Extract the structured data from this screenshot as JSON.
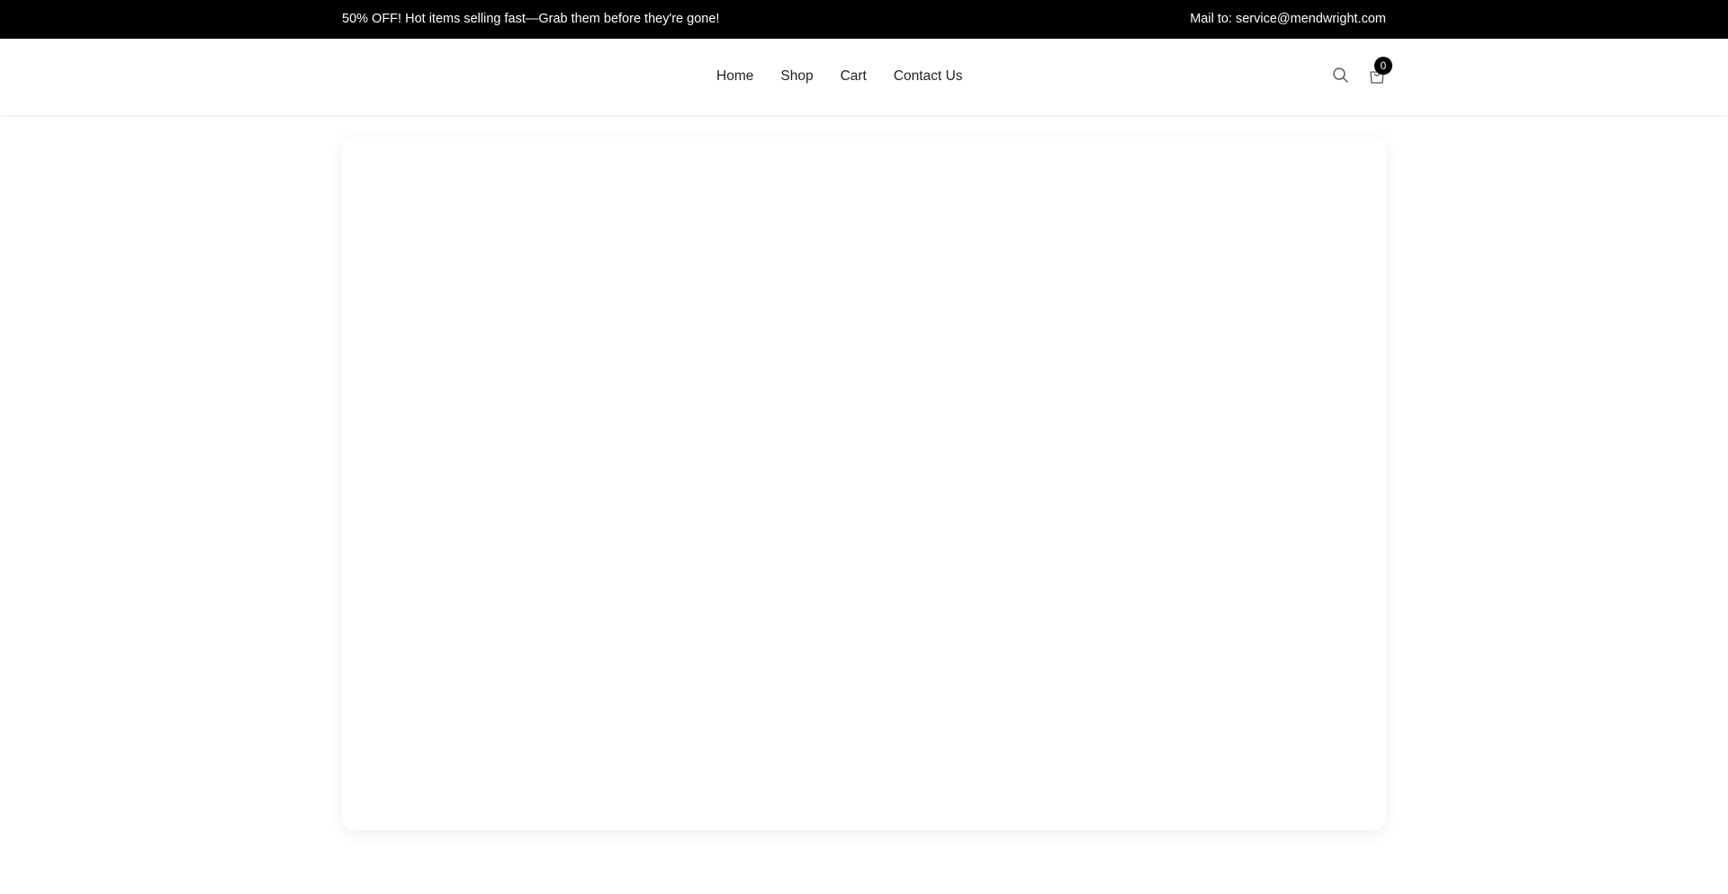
{
  "topbar": {
    "promo": "50% OFF! Hot items selling fast—Grab them before they're gone!",
    "mail": "Mail to: service@mendwright.com"
  },
  "nav": {
    "items": [
      {
        "label": "Home"
      },
      {
        "label": "Shop"
      },
      {
        "label": "Cart"
      },
      {
        "label": "Contact Us"
      }
    ]
  },
  "header": {
    "search_icon": "search-icon",
    "cart_icon": "shopping-bag-icon",
    "cart_count": "0"
  },
  "colors": {
    "topbar_bg": "#000000",
    "topbar_text": "#ffffff",
    "badge_bg": "#000000"
  }
}
